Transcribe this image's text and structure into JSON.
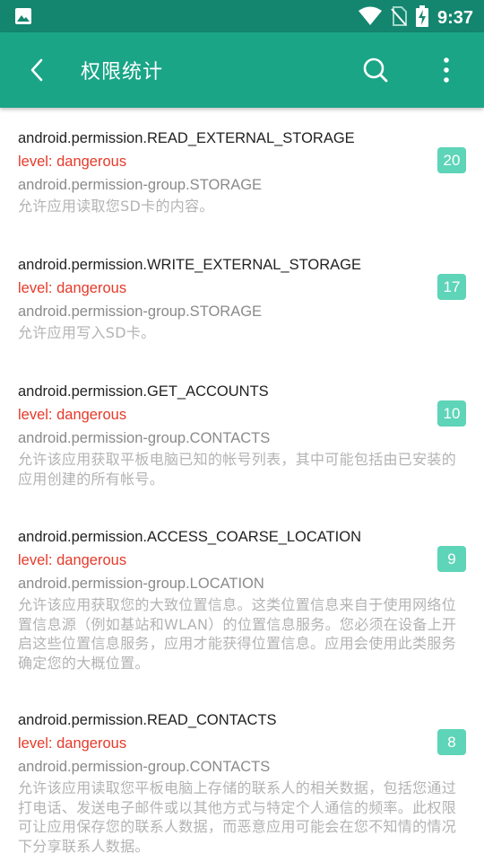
{
  "status_bar": {
    "time": "9:37"
  },
  "app_bar": {
    "title": "权限统计"
  },
  "permissions": [
    {
      "name": "android.permission.READ_EXTERNAL_STORAGE",
      "level": "level: dangerous",
      "group": "android.permission-group.STORAGE",
      "description": "允许应用读取您SD卡的内容。",
      "count": "20"
    },
    {
      "name": "android.permission.WRITE_EXTERNAL_STORAGE",
      "level": "level: dangerous",
      "group": "android.permission-group.STORAGE",
      "description": "允许应用写入SD卡。",
      "count": "17"
    },
    {
      "name": "android.permission.GET_ACCOUNTS",
      "level": "level: dangerous",
      "group": "android.permission-group.CONTACTS",
      "description": "允许该应用获取平板电脑已知的帐号列表，其中可能包括由已安装的应用创建的所有帐号。",
      "count": "10"
    },
    {
      "name": "android.permission.ACCESS_COARSE_LOCATION",
      "level": "level: dangerous",
      "group": "android.permission-group.LOCATION",
      "description": "允许该应用获取您的大致位置信息。这类位置信息来自于使用网络位置信息源（例如基站和WLAN）的位置信息服务。您必须在设备上开启这些位置信息服务，应用才能获得位置信息。应用会使用此类服务确定您的大概位置。",
      "count": "9"
    },
    {
      "name": "android.permission.READ_CONTACTS",
      "level": "level: dangerous",
      "group": "android.permission-group.CONTACTS",
      "description": "允许该应用读取您平板电脑上存储的联系人的相关数据，包括您通过打电话、发送电子邮件或以其他方式与特定个人通信的频率。此权限可让应用保存您的联系人数据，而恶意应用可能会在您不知情的情况下分享联系人数据。",
      "count": "8"
    }
  ]
}
